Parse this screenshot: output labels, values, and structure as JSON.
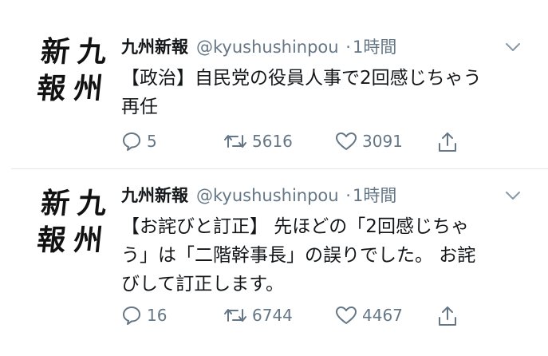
{
  "tweets": [
    {
      "avatar_chars": [
        "新",
        "九",
        "報",
        "州"
      ],
      "name": "九州新報",
      "handle": "@kyushushinpou",
      "separator": "·",
      "time": "1時間",
      "text": "【政治】自民党の役員人事で2回感じちゃう\n再任",
      "replies": "5",
      "retweets": "5616",
      "likes": "3091"
    },
    {
      "avatar_chars": [
        "新",
        "九",
        "報",
        "州"
      ],
      "name": "九州新報",
      "handle": "@kyushushinpou",
      "separator": "·",
      "time": "1時間",
      "text": "【お詫びと訂正】 先ほどの「2回感じちゃ\nう」は「二階幹事長」の誤りでした。 お詫\nびして訂正します。",
      "replies": "16",
      "retweets": "6744",
      "likes": "4467"
    }
  ],
  "icons": {
    "avatar": "newspaper-logo",
    "menu": "chevron-down-icon",
    "reply": "reply-icon",
    "retweet": "retweet-icon",
    "like": "heart-icon",
    "share": "share-icon"
  },
  "colors": {
    "text": "#14171a",
    "secondary": "#657786",
    "divider": "#e1e8ed",
    "background": "#ffffff"
  }
}
